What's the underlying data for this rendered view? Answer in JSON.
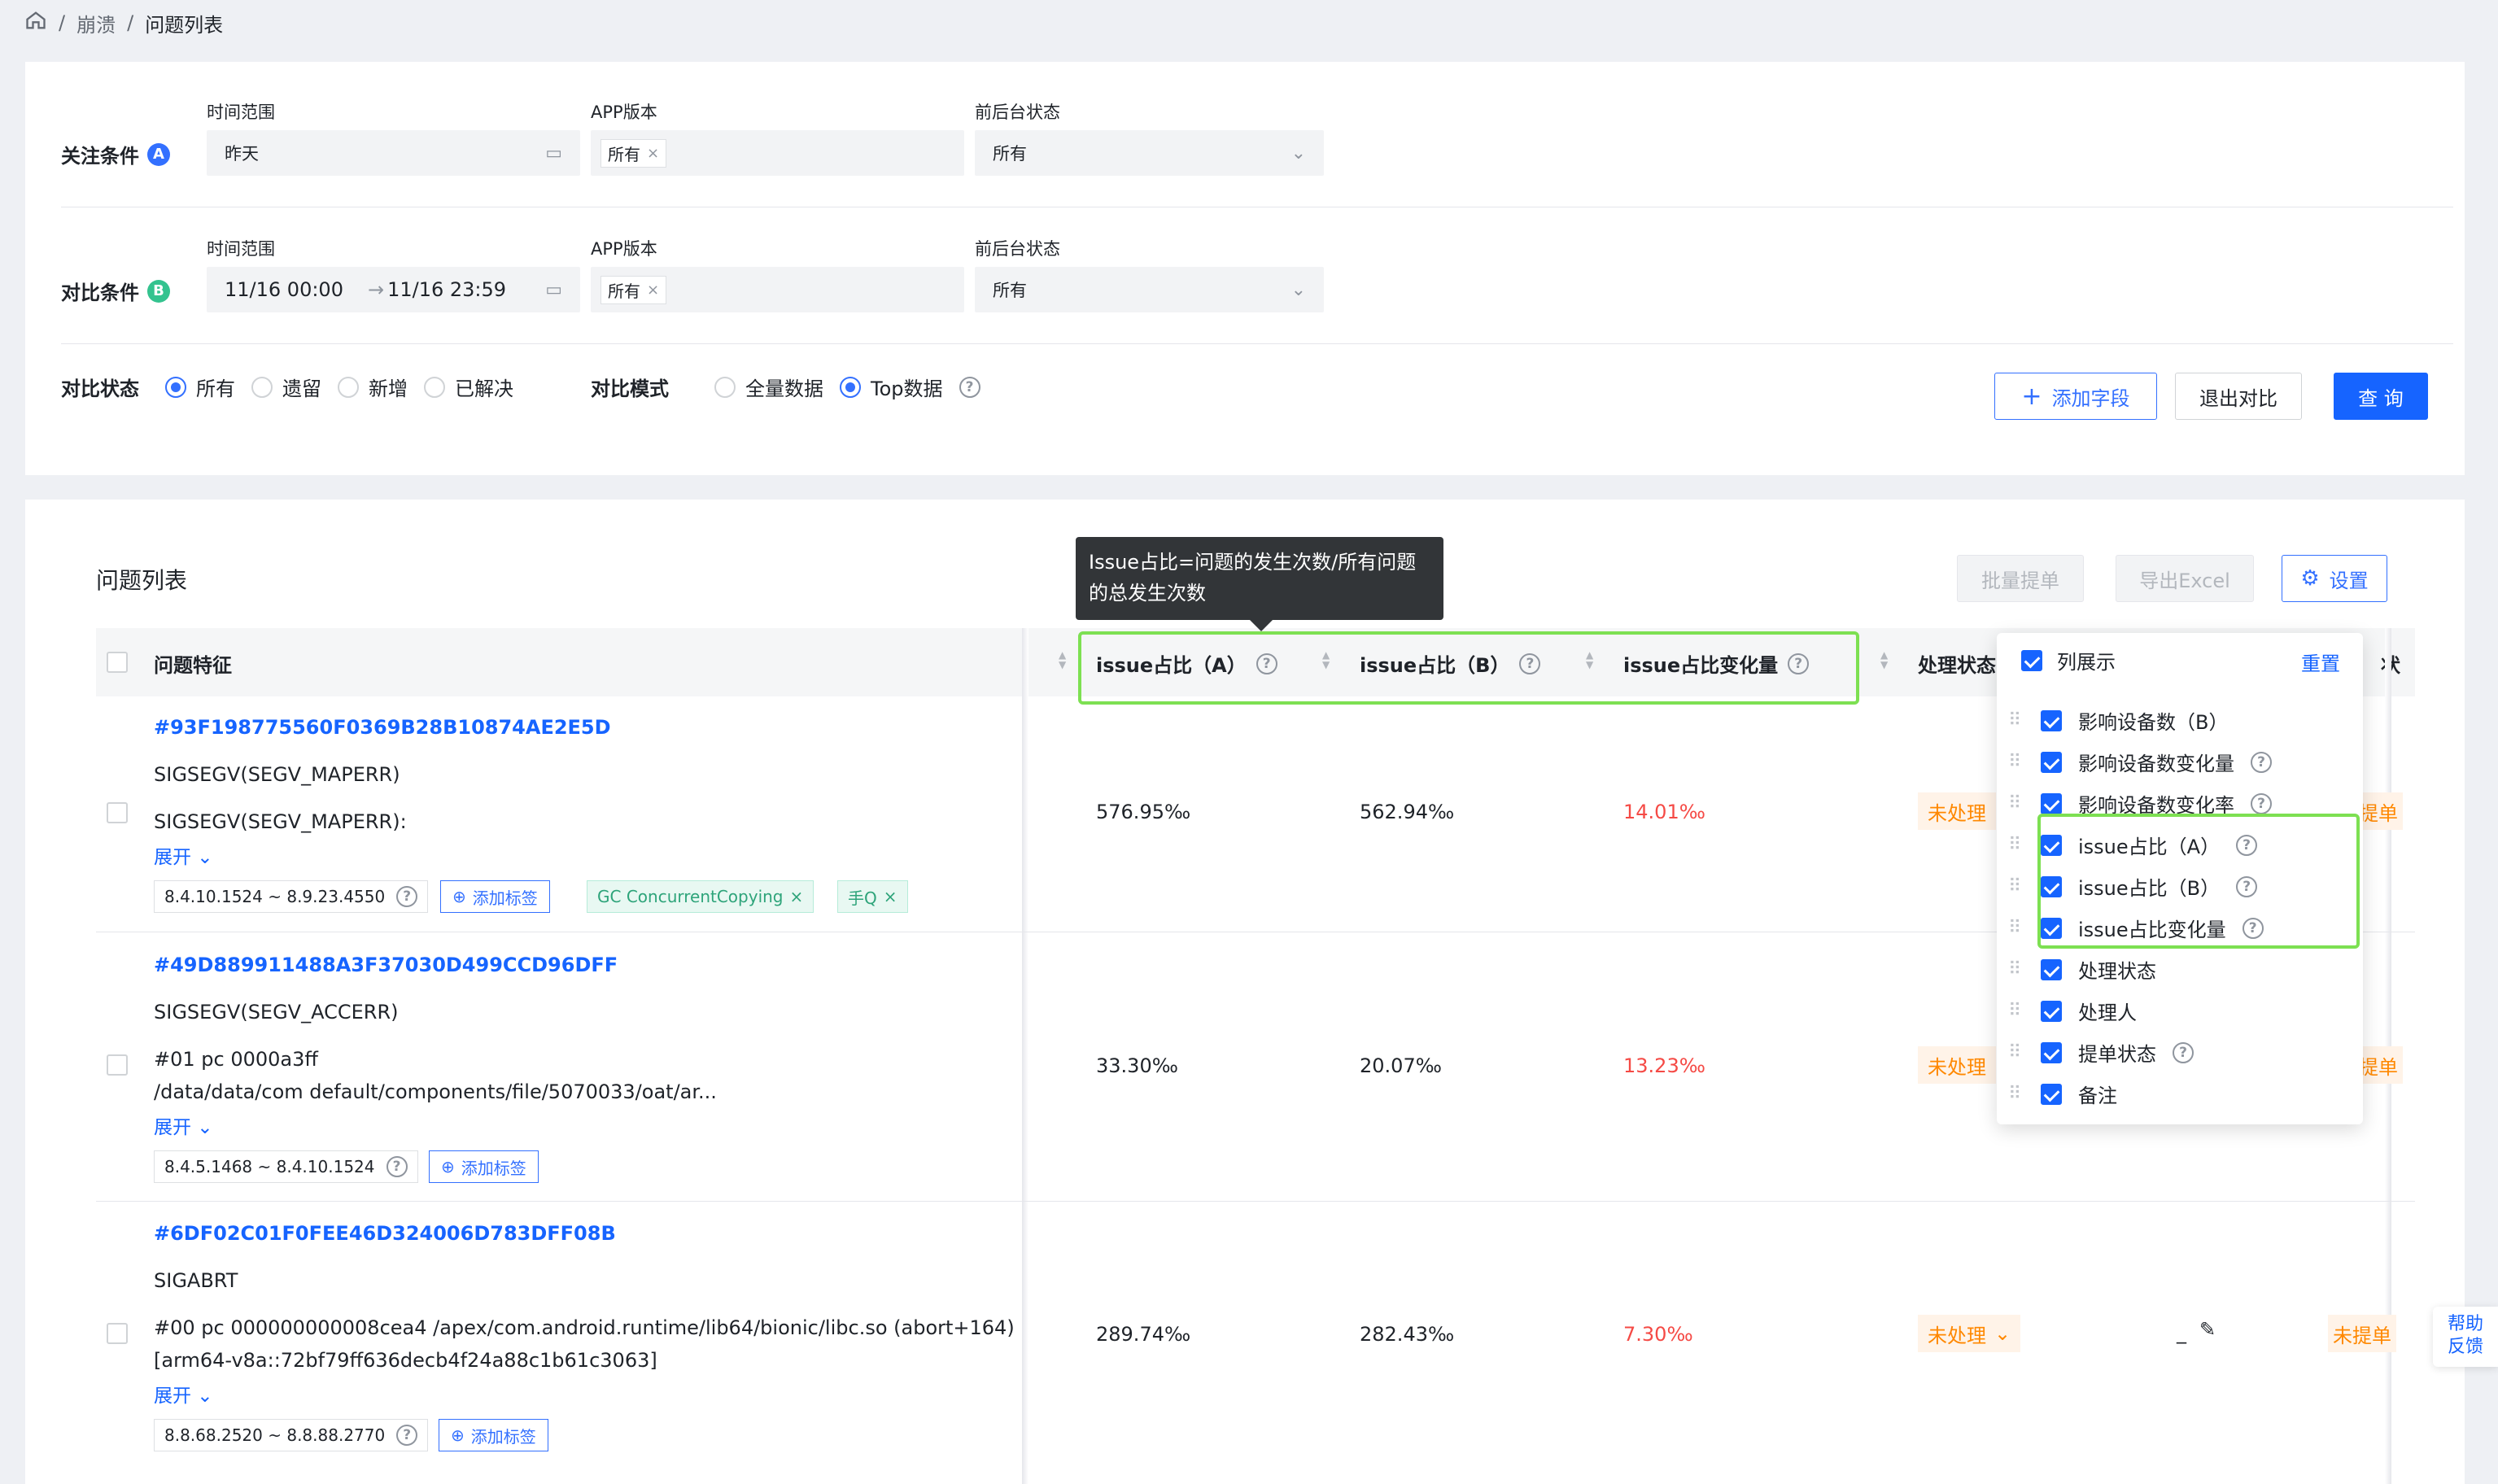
{
  "breadcrumb": {
    "items": [
      "崩溃",
      "问题列表"
    ]
  },
  "filter": {
    "rowA": {
      "label": "关注条件",
      "badge": "A",
      "time_label": "时间范围",
      "time_value": "昨天",
      "app_label": "APP版本",
      "app_chip": "所有",
      "bg_label": "前后台状态",
      "bg_value": "所有"
    },
    "rowB": {
      "label": "对比条件",
      "badge": "B",
      "time_label": "时间范围",
      "time_start": "11/16 00:00",
      "time_arrow": "→",
      "time_end": "11/16 23:59",
      "app_label": "APP版本",
      "app_chip": "所有",
      "bg_label": "前后台状态",
      "bg_value": "所有"
    },
    "compare_state": {
      "label": "对比状态",
      "options": [
        "所有",
        "遗留",
        "新增",
        "已解决"
      ],
      "selected": "所有"
    },
    "compare_mode": {
      "label": "对比模式",
      "options": [
        "全量数据",
        "Top数据"
      ],
      "selected": "Top数据"
    },
    "buttons": {
      "add_field": "添加字段",
      "exit_compare": "退出对比",
      "query": "查 询"
    }
  },
  "list": {
    "title": "问题列表",
    "toolbar": {
      "batch": "批量提单",
      "export": "导出Excel",
      "settings": "设置"
    },
    "tooltip": "Issue占比=问题的发生次数/所有问题的总发生次数",
    "columns": {
      "feature": "问题特征",
      "ratio_a": "issue占比（A）",
      "ratio_b": "issue占比（B）",
      "ratio_change": "issue占比变化量",
      "status": "处理状态",
      "status_cut": "状"
    },
    "rows": [
      {
        "id": "#93F198775560F0369B28B10874AE2E5D",
        "line1": "SIGSEGV(SEGV_MAPERR)",
        "line2": "SIGSEGV(SEGV_MAPERR):",
        "line3": "",
        "expand": "展开",
        "version": "8.4.10.1524 ~ 8.9.23.4550",
        "add_tag": "添加标签",
        "tags": [
          "GC ConcurrentCopying",
          "手Q"
        ],
        "ratio_a": "576.95‰",
        "ratio_b": "562.94‰",
        "change": "14.01‰",
        "status": "未处理",
        "ticket": "提单"
      },
      {
        "id": "#49D889911488A3F37030D499CCD96DFF",
        "line1": "SIGSEGV(SEGV_ACCERR)",
        "line2": "#01 pc 0000a3ff",
        "line3": "/data/data/com default/components/file/5070033/oat/ar...",
        "expand": "展开",
        "version": "8.4.5.1468 ~ 8.4.10.1524",
        "add_tag": "添加标签",
        "tags": [],
        "ratio_a": "33.30‰",
        "ratio_b": "20.07‰",
        "change": "13.23‰",
        "status": "未处理",
        "ticket": "提单"
      },
      {
        "id": "#6DF02C01F0FEE46D324006D783DFF08B",
        "line1": "SIGABRT",
        "line2": "#00 pc 000000000008cea4 /apex/com.android.runtime/lib64/bionic/libc.so (abort+164)",
        "line3": "[arm64-v8a::72bf79ff636decb4f24a88c1b61c3063]",
        "expand": "展开",
        "version": "8.8.68.2520 ~ 8.8.88.2770",
        "add_tag": "添加标签",
        "tags": [],
        "ratio_a": "289.74‰",
        "ratio_b": "282.43‰",
        "change": "7.30‰",
        "status": "未处理",
        "ticket": "未提单",
        "handler": "_"
      }
    ]
  },
  "popup": {
    "title": "列展示",
    "reset": "重置",
    "items": [
      {
        "label": "影响设备数（B）",
        "help": false
      },
      {
        "label": "影响设备数变化量",
        "help": true
      },
      {
        "label": "影响设备数变化率",
        "help": true
      },
      {
        "label": "issue占比（A）",
        "help": true
      },
      {
        "label": "issue占比（B）",
        "help": true
      },
      {
        "label": "issue占比变化量",
        "help": true
      },
      {
        "label": "处理状态",
        "help": false
      },
      {
        "label": "处理人",
        "help": false
      },
      {
        "label": "提单状态",
        "help": true
      },
      {
        "label": "备注",
        "help": false
      }
    ]
  },
  "help_float": {
    "line1": "帮助",
    "line2": "反馈"
  },
  "colors": {
    "primary": "#1664ff",
    "red": "#f54a45",
    "orange": "#ff8800",
    "highlight": "#7de052"
  }
}
